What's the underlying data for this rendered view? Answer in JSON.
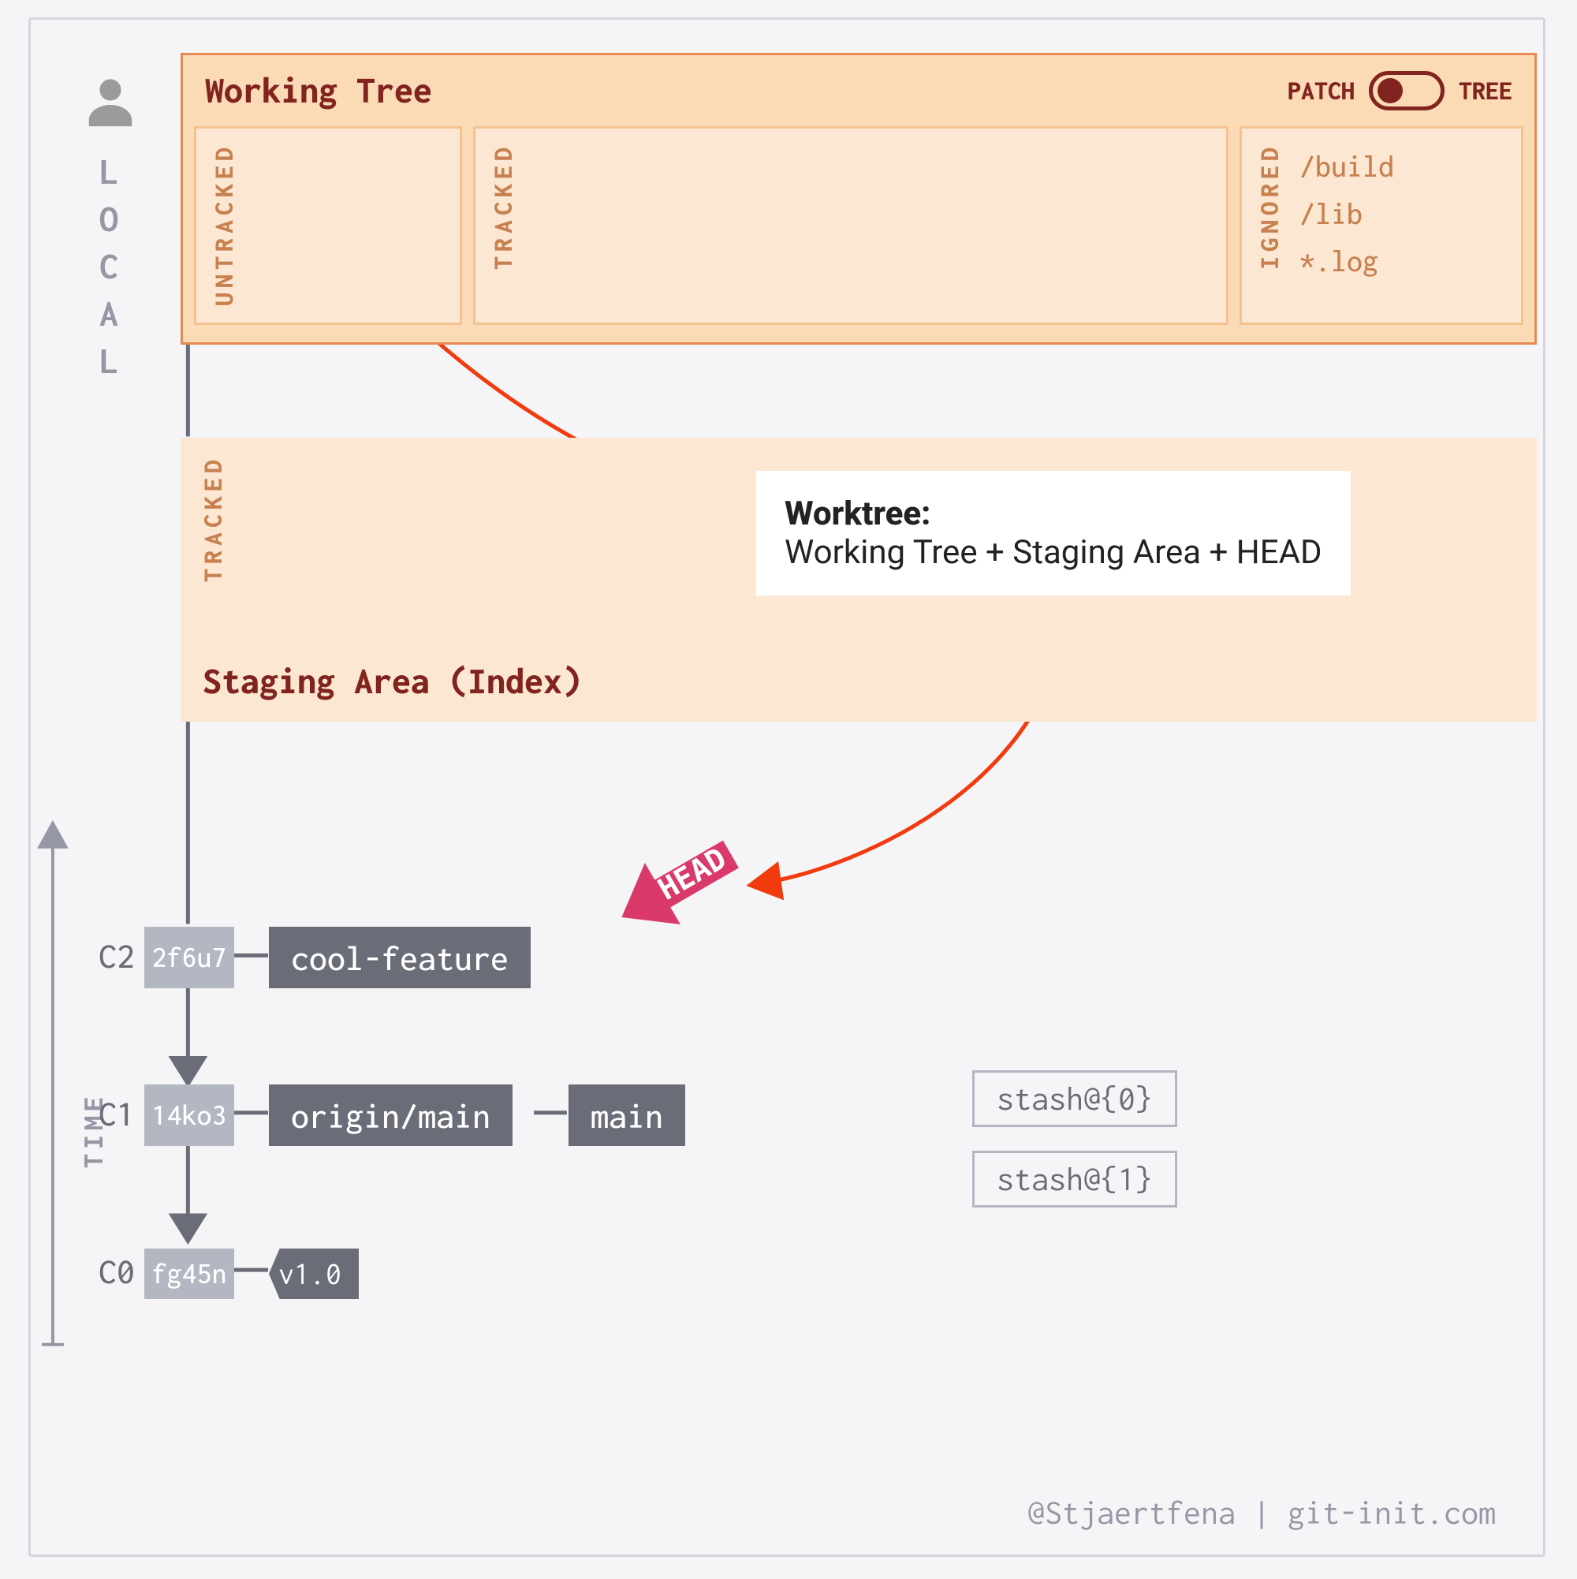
{
  "sidebar": {
    "local_letters": [
      "L",
      "O",
      "C",
      "A",
      "L"
    ],
    "time_label": "TIME"
  },
  "working_tree": {
    "title": "Working Tree",
    "toggle_left": "PATCH",
    "toggle_right": "TREE",
    "untracked_label": "UNTRACKED",
    "tracked_label": "TRACKED",
    "ignored_label": "IGNORED",
    "ignored_items": [
      "/build",
      "/lib",
      "*.log"
    ]
  },
  "staging": {
    "tracked_label": "TRACKED",
    "title": "Staging Area (Index)"
  },
  "tooltip": {
    "heading": "Worktree:",
    "body": "Working Tree + Staging Area + HEAD"
  },
  "commits": [
    {
      "label": "C2",
      "hash": "2f6u7",
      "refs": [
        "cool-feature"
      ]
    },
    {
      "label": "C1",
      "hash": "14ko3",
      "refs": [
        "origin/main",
        "main"
      ]
    },
    {
      "label": "C0",
      "hash": "fg45n",
      "tag": "v1.0"
    }
  ],
  "head_label": "HEAD",
  "stashes": [
    "stash@{0}",
    "stash@{1}"
  ],
  "credit": "@Stjaertfena | git-init.com",
  "colors": {
    "accent": "#81231e",
    "peach": "#fbdbb6",
    "peach_light": "#fce8d2",
    "arrow": "#f13b0f",
    "grey_ref": "#6a6d78",
    "grey_hash": "#b3b7c2",
    "head_pink": "#d93a6a"
  }
}
